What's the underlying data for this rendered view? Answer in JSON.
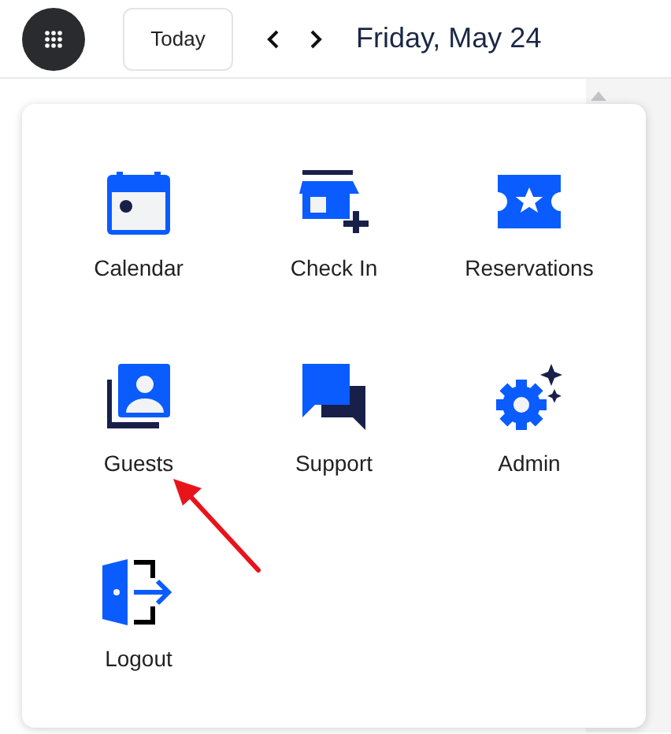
{
  "header": {
    "today_button": "Today",
    "date_title": "Friday, May 24"
  },
  "menu": {
    "items": [
      {
        "label": "Calendar",
        "kind": "calendar"
      },
      {
        "label": "Check In",
        "kind": "store"
      },
      {
        "label": "Reservations",
        "kind": "ticket"
      },
      {
        "label": "Guests",
        "kind": "contacts"
      },
      {
        "label": "Support",
        "kind": "chat"
      },
      {
        "label": "Admin",
        "kind": "gear"
      },
      {
        "label": "Logout",
        "kind": "exit"
      }
    ]
  }
}
